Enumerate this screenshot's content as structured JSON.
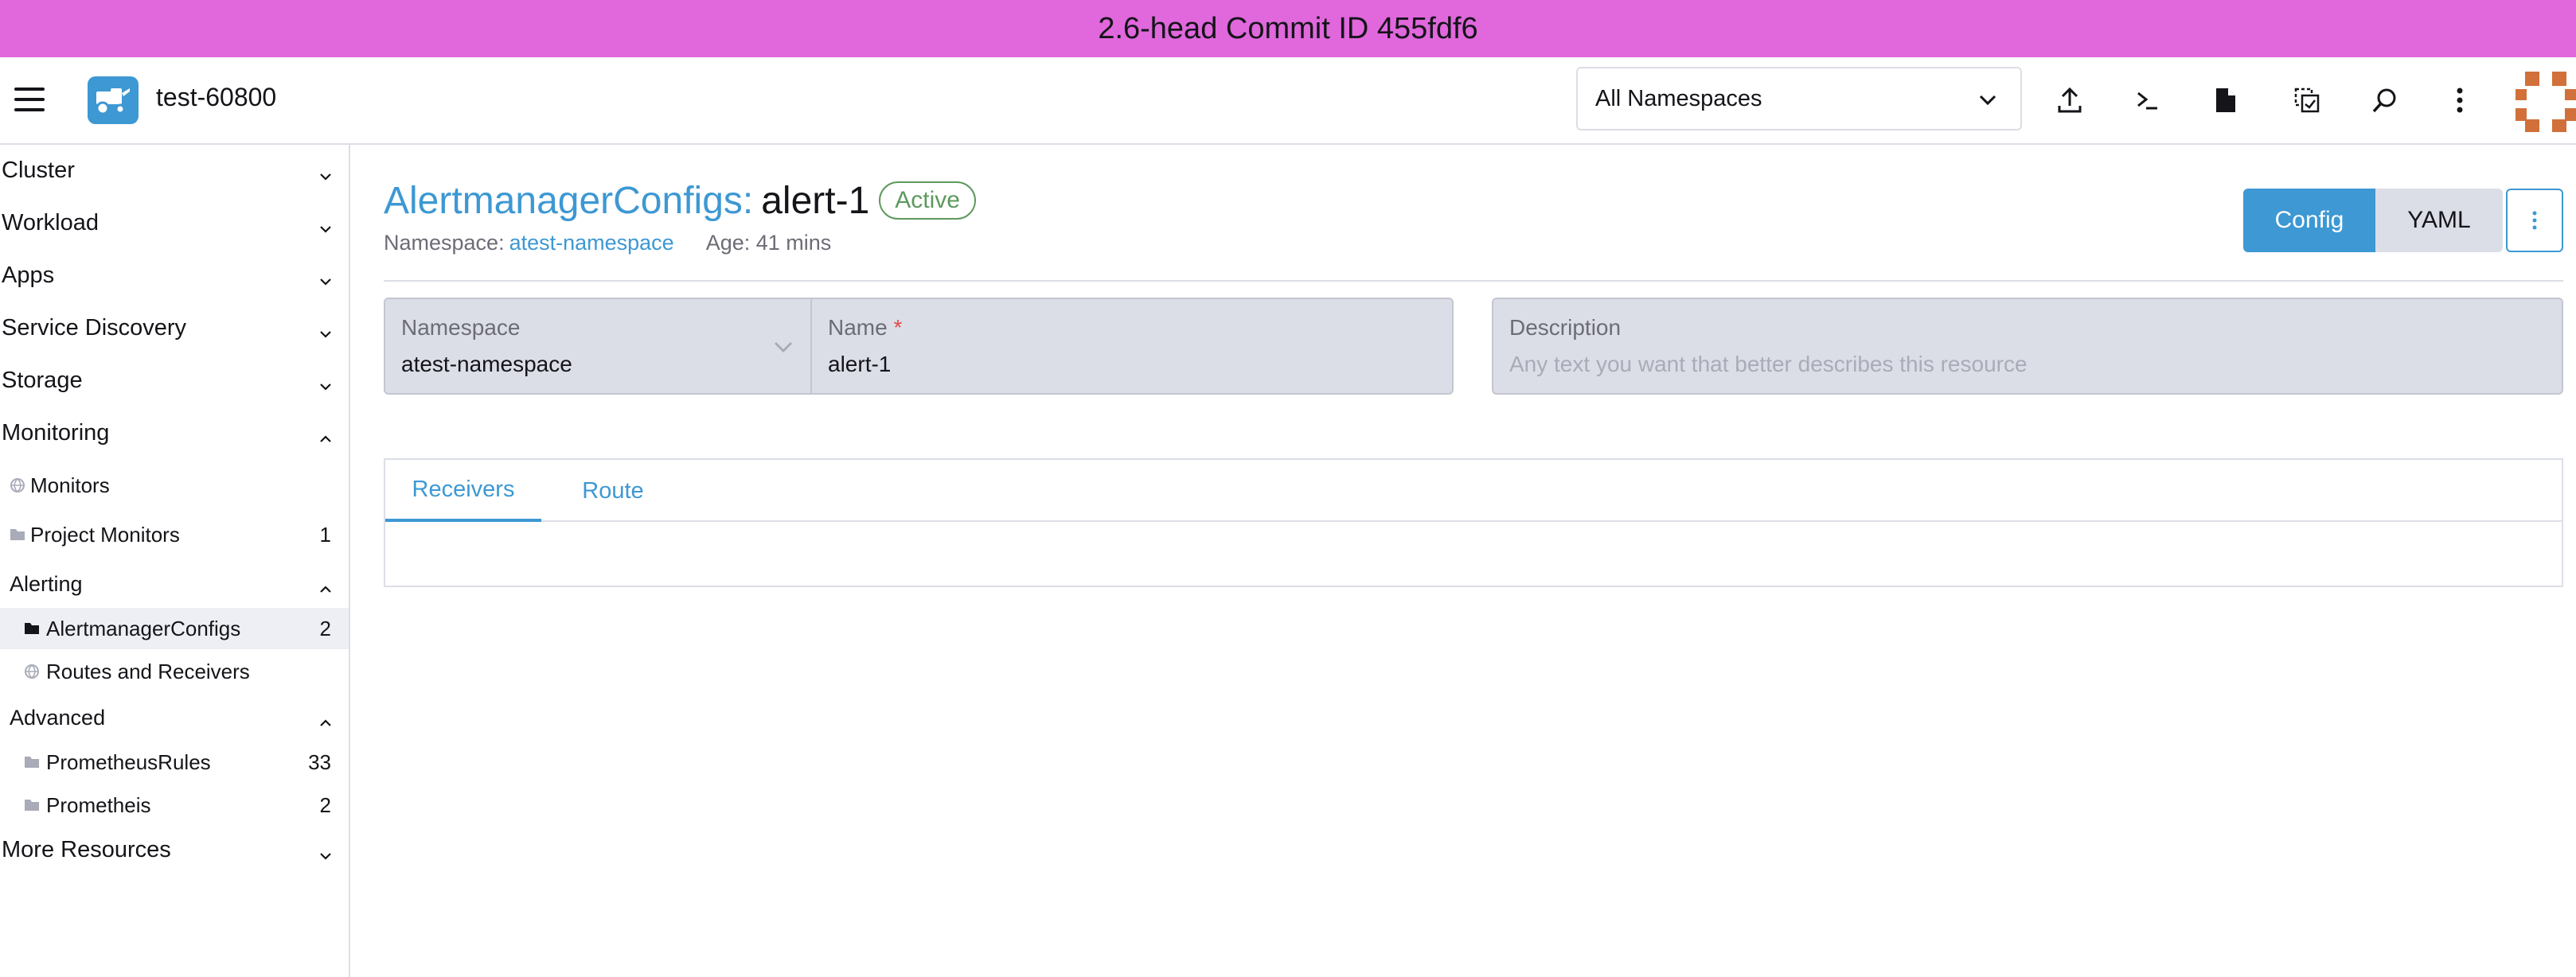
{
  "banner": {
    "text": "2.6-head Commit ID 455fdf6"
  },
  "header": {
    "cluster_name": "test-60800",
    "namespace_select": {
      "value": "All Namespaces"
    },
    "icons": [
      "upload-icon",
      "kubectl-shell-icon",
      "file-icon",
      "copy-config-icon",
      "search-icon",
      "more-vertical-icon"
    ]
  },
  "sidebar": {
    "groups": [
      {
        "label": "Cluster"
      },
      {
        "label": "Workload"
      },
      {
        "label": "Apps"
      },
      {
        "label": "Service Discovery"
      },
      {
        "label": "Storage"
      },
      {
        "label": "Monitoring"
      },
      {
        "label": "More Resources"
      }
    ],
    "monitoring_items": [
      {
        "label": "Monitors",
        "count": ""
      },
      {
        "label": "Project Monitors",
        "count": "1"
      }
    ],
    "alerting": {
      "label": "Alerting",
      "items": [
        {
          "label": "AlertmanagerConfigs",
          "count": "2"
        },
        {
          "label": "Routes and Receivers",
          "count": ""
        }
      ]
    },
    "advanced": {
      "label": "Advanced",
      "items": [
        {
          "label": "PrometheusRules",
          "count": "33"
        },
        {
          "label": "Prometheis",
          "count": "2"
        }
      ]
    }
  },
  "main": {
    "title_type": "AlertmanagerConfigs:",
    "title_name": "alert-1",
    "status": "Active",
    "namespace_label": "Namespace:",
    "namespace_value": "atest-namespace",
    "age": "Age: 41 mins",
    "buttons": {
      "config": "Config",
      "yaml": "YAML"
    },
    "fields": {
      "namespace": {
        "label": "Namespace",
        "value": "atest-namespace"
      },
      "name": {
        "label": "Name",
        "required": "*",
        "value": "alert-1"
      },
      "description": {
        "label": "Description",
        "placeholder": "Any text you want that better describes this resource"
      }
    },
    "tabs": [
      {
        "label": "Receivers"
      },
      {
        "label": "Route"
      }
    ]
  },
  "colors": {
    "banner": "#e067dc",
    "accent": "#3d98d3",
    "status_active": "#5d995d",
    "field_bg": "#dcdee7"
  }
}
